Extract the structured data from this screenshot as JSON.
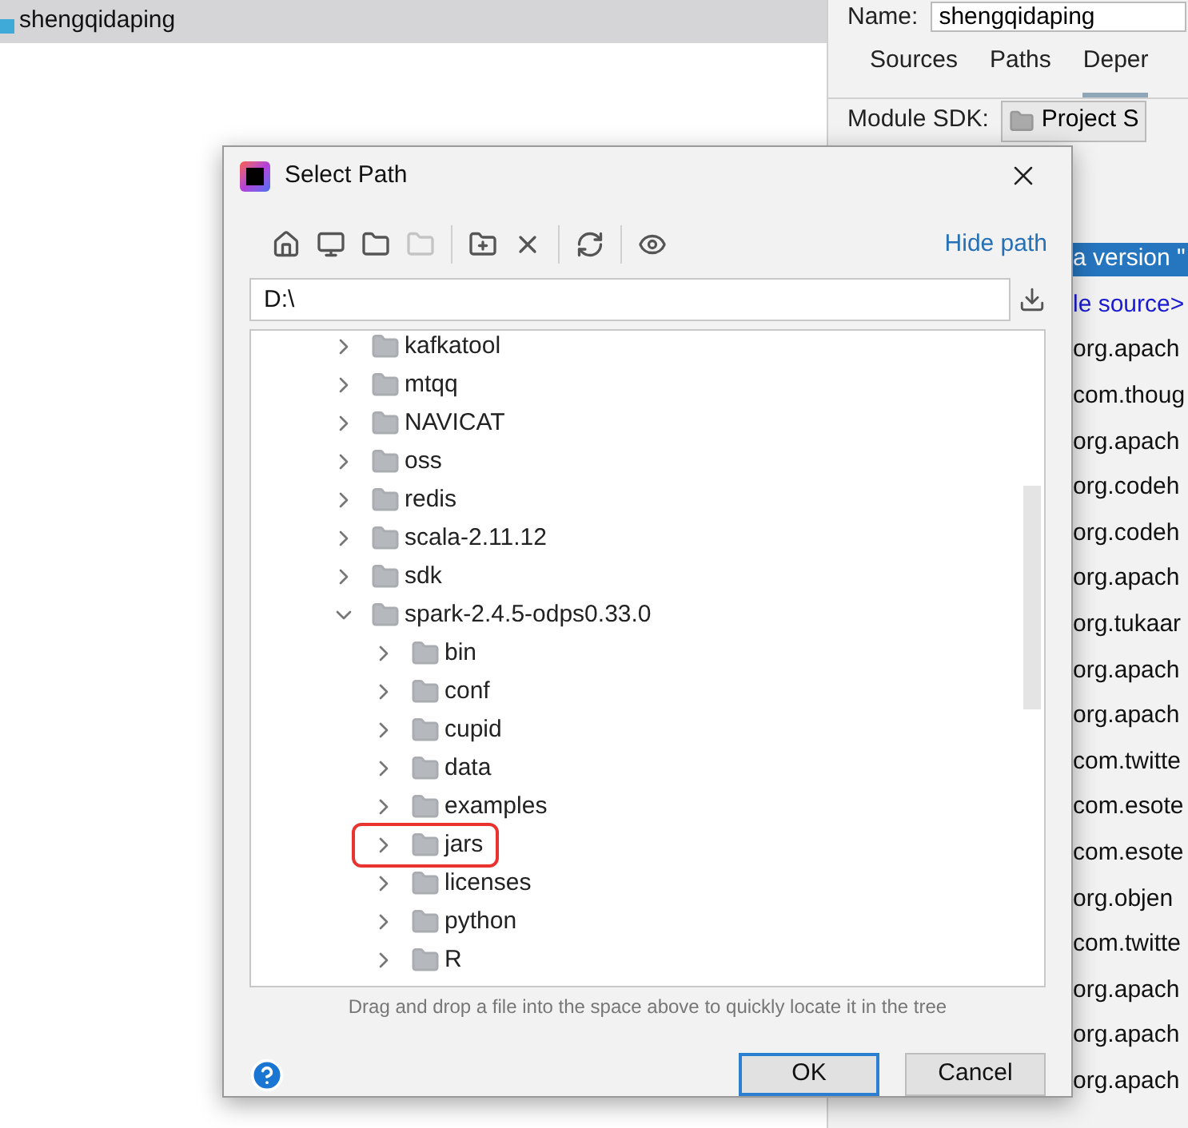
{
  "project_tree": {
    "root": {
      "label": "shengqidaping",
      "selected": true
    }
  },
  "module_settings": {
    "name_label": "Name:",
    "name_value": "shengqidaping",
    "tabs": [
      {
        "label": "Sources",
        "selected": false
      },
      {
        "label": "Paths",
        "selected": false
      },
      {
        "label": "Deper",
        "selected": true
      }
    ],
    "sdk_label": "Module SDK:",
    "sdk_value": "Project S",
    "dependencies": [
      {
        "label": "a version \"",
        "selected": true,
        "kind": "entry"
      },
      {
        "label": "le source>",
        "selected": false,
        "kind": "source"
      },
      {
        "label": "org.apach",
        "selected": false,
        "kind": "library"
      },
      {
        "label": "com.thoug",
        "selected": false,
        "kind": "library"
      },
      {
        "label": "org.apach",
        "selected": false,
        "kind": "library"
      },
      {
        "label": "org.codeh",
        "selected": false,
        "kind": "library"
      },
      {
        "label": "org.codeh",
        "selected": false,
        "kind": "library"
      },
      {
        "label": "org.apach",
        "selected": false,
        "kind": "library"
      },
      {
        "label": "org.tukaar",
        "selected": false,
        "kind": "library"
      },
      {
        "label": "org.apach",
        "selected": false,
        "kind": "library"
      },
      {
        "label": "org.apach",
        "selected": false,
        "kind": "library"
      },
      {
        "label": "com.twitte",
        "selected": false,
        "kind": "library"
      },
      {
        "label": "com.esote",
        "selected": false,
        "kind": "library"
      },
      {
        "label": "com.esote",
        "selected": false,
        "kind": "library"
      },
      {
        "label": "org.objen",
        "selected": false,
        "kind": "library"
      },
      {
        "label": "com.twitte",
        "selected": false,
        "kind": "library"
      },
      {
        "label": "org.apach",
        "selected": false,
        "kind": "library"
      },
      {
        "label": "org.apach",
        "selected": false,
        "kind": "library"
      },
      {
        "label": "org.apach",
        "selected": false,
        "kind": "library"
      }
    ]
  },
  "dialog": {
    "title": "Select Path",
    "toolbar": [
      {
        "kind": "home",
        "disabled": false
      },
      {
        "kind": "desktop",
        "disabled": false
      },
      {
        "kind": "module",
        "disabled": false
      },
      {
        "kind": "module",
        "disabled": true
      },
      {
        "kind": "separator"
      },
      {
        "kind": "new-folder",
        "disabled": false
      },
      {
        "kind": "delete",
        "disabled": false
      },
      {
        "kind": "separator"
      },
      {
        "kind": "refresh",
        "disabled": false
      },
      {
        "kind": "separator"
      },
      {
        "kind": "show-hidden",
        "disabled": false
      }
    ],
    "hide_path_link": "Hide path",
    "path_value": "D:\\",
    "tree": [
      {
        "label": "kafkatool",
        "expanded": false
      },
      {
        "label": "mtqq",
        "expanded": false
      },
      {
        "label": "NAVICAT",
        "expanded": false
      },
      {
        "label": "oss",
        "expanded": false
      },
      {
        "label": "redis",
        "expanded": false
      },
      {
        "label": "scala-2.11.12",
        "expanded": false
      },
      {
        "label": "sdk",
        "expanded": false
      },
      {
        "label": "spark-2.4.5-odps0.33.0",
        "expanded": true,
        "children": [
          {
            "label": "bin",
            "expanded": false
          },
          {
            "label": "conf",
            "expanded": false
          },
          {
            "label": "cupid",
            "expanded": false
          },
          {
            "label": "data",
            "expanded": false
          },
          {
            "label": "examples",
            "expanded": false
          },
          {
            "label": "jars",
            "expanded": false,
            "annotated": true
          },
          {
            "label": "licenses",
            "expanded": false
          },
          {
            "label": "python",
            "expanded": false
          },
          {
            "label": "R",
            "expanded": false
          }
        ]
      }
    ],
    "hint": "Drag and drop a file into the space above to quickly locate it in the tree",
    "buttons": [
      {
        "label": "OK",
        "kind": "default"
      },
      {
        "label": "Cancel",
        "kind": "normal"
      }
    ]
  }
}
